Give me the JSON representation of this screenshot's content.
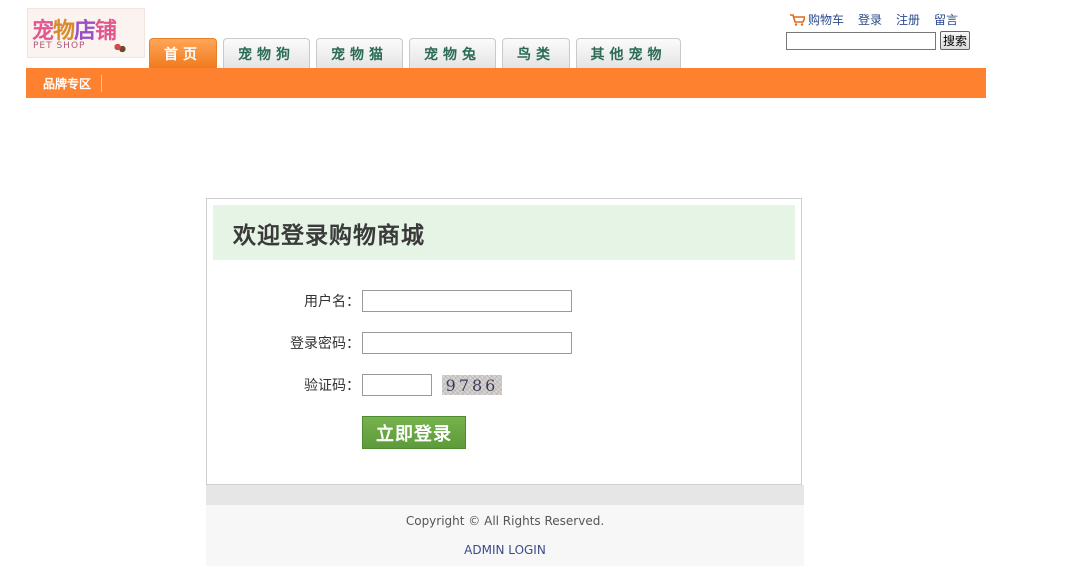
{
  "logo": {
    "cn_chars": [
      "宠",
      "物",
      "店",
      "铺"
    ],
    "en": "PET SHOP"
  },
  "nav": {
    "tabs": [
      {
        "label": "首页",
        "active": true
      },
      {
        "label": "宠物狗",
        "active": false
      },
      {
        "label": "宠物猫",
        "active": false
      },
      {
        "label": "宠物兔",
        "active": false
      },
      {
        "label": "鸟类",
        "active": false
      },
      {
        "label": "其他宠物",
        "active": false
      }
    ]
  },
  "subnav": {
    "brand_label": "品牌专区"
  },
  "top_links": {
    "cart": "购物车",
    "login": "登录",
    "register": "注册",
    "message": "留言"
  },
  "search": {
    "value": "",
    "button_label": "搜索"
  },
  "login": {
    "title": "欢迎登录购物商城",
    "username_label": "用户名：",
    "username_value": "",
    "password_label": "登录密码：",
    "password_value": "",
    "captcha_label": "验证码：",
    "captcha_value": "",
    "captcha_text": "9786",
    "submit_label": "立即登录"
  },
  "footer": {
    "copyright": "Copyright © All Rights Reserved.",
    "admin_link": "ADMIN LOGIN"
  },
  "colors": {
    "accent": "#fe8130",
    "login_header_bg": "#e6f4e6",
    "login_button": "#6aa843",
    "tab_text": "#2c6b56"
  }
}
